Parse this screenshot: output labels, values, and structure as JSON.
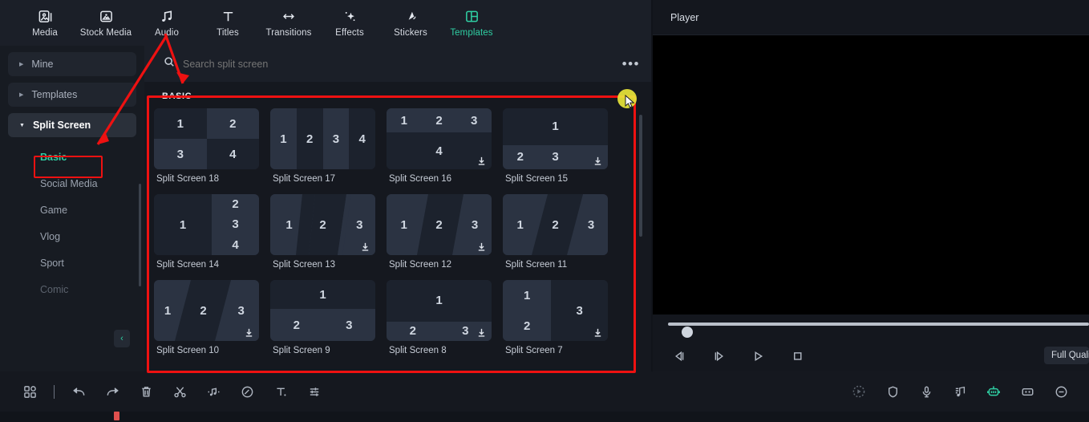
{
  "topbar": {
    "items": [
      {
        "label": "Media",
        "icon": "media-icon",
        "active": false
      },
      {
        "label": "Stock Media",
        "icon": "stock-media-icon",
        "active": false
      },
      {
        "label": "Audio",
        "icon": "audio-icon",
        "active": false
      },
      {
        "label": "Titles",
        "icon": "titles-icon",
        "active": false
      },
      {
        "label": "Transitions",
        "icon": "transitions-icon",
        "active": false
      },
      {
        "label": "Effects",
        "icon": "effects-icon",
        "active": false
      },
      {
        "label": "Stickers",
        "icon": "stickers-icon",
        "active": false
      },
      {
        "label": "Templates",
        "icon": "templates-icon",
        "active": true
      }
    ]
  },
  "sidebar": {
    "groups": [
      {
        "label": "Mine",
        "expanded": false
      },
      {
        "label": "Templates",
        "expanded": false
      },
      {
        "label": "Split Screen",
        "expanded": true
      }
    ],
    "subitems": [
      {
        "label": "Basic",
        "selected": true
      },
      {
        "label": "Social Media",
        "selected": false
      },
      {
        "label": "Game",
        "selected": false
      },
      {
        "label": "Vlog",
        "selected": false
      },
      {
        "label": "Sport",
        "selected": false
      },
      {
        "label": "Comic",
        "selected": false
      }
    ],
    "collapse_label": "‹"
  },
  "search": {
    "placeholder": "Search split screen",
    "value": "",
    "more_label": "•••"
  },
  "browser": {
    "section_title": "BASIC",
    "templates": [
      {
        "name": "Split Screen 18",
        "panes": 4,
        "download": false
      },
      {
        "name": "Split Screen 17",
        "panes": 4,
        "download": false
      },
      {
        "name": "Split Screen 16",
        "panes": 4,
        "download": true
      },
      {
        "name": "Split Screen 15",
        "panes": 3,
        "download": true
      },
      {
        "name": "Split Screen 14",
        "panes": 4,
        "download": false
      },
      {
        "name": "Split Screen 13",
        "panes": 3,
        "download": true
      },
      {
        "name": "Split Screen 12",
        "panes": 3,
        "download": true
      },
      {
        "name": "Split Screen 11",
        "panes": 3,
        "download": false
      },
      {
        "name": "Split Screen 10",
        "panes": 3,
        "download": true
      },
      {
        "name": "Split Screen 9",
        "panes": 3,
        "download": false
      },
      {
        "name": "Split Screen 8",
        "panes": 3,
        "download": true
      },
      {
        "name": "Split Screen 7",
        "panes": 3,
        "download": true
      }
    ],
    "pane_numbers": [
      "1",
      "2",
      "3",
      "4"
    ]
  },
  "player": {
    "title": "Player",
    "quality_label": "Full Quality",
    "controls": [
      {
        "name": "previous-frame-button",
        "icon": "previous-frame-icon"
      },
      {
        "name": "next-frame-button",
        "icon": "next-frame-icon"
      },
      {
        "name": "play-button",
        "icon": "play-icon"
      },
      {
        "name": "stop-button",
        "icon": "stop-icon"
      }
    ],
    "progress_percent": 0
  },
  "bottom_toolbar": {
    "left": [
      {
        "name": "apps-grid-button",
        "icon": "apps-grid-icon"
      },
      {
        "name": "undo-button",
        "icon": "undo-icon"
      },
      {
        "name": "redo-button",
        "icon": "redo-icon"
      },
      {
        "name": "delete-button",
        "icon": "trash-icon"
      },
      {
        "name": "split-button",
        "icon": "scissors-icon"
      },
      {
        "name": "detach-audio-button",
        "icon": "music-detach-icon"
      },
      {
        "name": "mask-button",
        "icon": "mask-icon"
      },
      {
        "name": "text-button",
        "icon": "text-icon"
      },
      {
        "name": "adjust-button",
        "icon": "sliders-icon"
      }
    ],
    "right": [
      {
        "name": "speed-button",
        "icon": "speed-icon",
        "accent": false,
        "dim": true
      },
      {
        "name": "stabilize-button",
        "icon": "shield-icon",
        "accent": false,
        "dim": false
      },
      {
        "name": "voiceover-button",
        "icon": "microphone-icon",
        "accent": false,
        "dim": false
      },
      {
        "name": "audio-mixer-button",
        "icon": "audio-note-icon",
        "accent": false,
        "dim": false
      },
      {
        "name": "ai-tools-button",
        "icon": "ai-robot-icon",
        "accent": true,
        "dim": false
      },
      {
        "name": "marker-button",
        "icon": "marker-icon",
        "accent": false,
        "dim": false
      },
      {
        "name": "zoom-out-button",
        "icon": "zoom-out-icon",
        "accent": false,
        "dim": false
      }
    ]
  },
  "colors": {
    "accent": "#2fcfa3",
    "annotation": "#ee1111",
    "cursor_highlight": "#e8e53a",
    "playhead": "#e0504e",
    "panel_bg": "#15181f",
    "toolbar_bg": "#1b1f28"
  }
}
